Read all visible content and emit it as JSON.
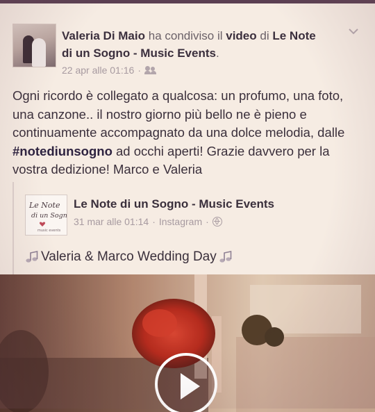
{
  "post": {
    "author": "Valeria Di Maio",
    "action_shared": "ha condiviso il",
    "object_video": "video",
    "prep": "di",
    "page_name": "Le Note di un Sogno - Music Events",
    "period": ".",
    "timestamp": "22 apr alle 01:16",
    "separator": "·",
    "audience_icon": "friends-icon",
    "menu_icon": "chevron-down-icon",
    "text_before_hashtag": "Ogni ricordo è collegato a qualcosa: un profumo, una foto, una canzone.. il nostro giorno più bello ne è pieno e continuamente accompagnato da una dolce melodia, dalle ",
    "hashtag": "#notediunsogno",
    "text_after_hashtag": " ad occhi aperti! Grazie davvero per la vostra dedizione! Marco e Valeria"
  },
  "shared": {
    "page_name": "Le Note di un Sogno - Music Events",
    "timestamp": "31 mar alle 01:14",
    "separator": "·",
    "source": "Instagram",
    "separator2": "·",
    "privacy_icon": "globe-icon",
    "logo_text_line1": "Le Note",
    "logo_text_line2": "di un Sogno",
    "logo_text_line3": "music events",
    "video_caption": "Valeria & Marco Wedding Day",
    "caption_icon": "music-note-icon",
    "play_icon": "play-icon"
  },
  "colors": {
    "accent_text": "#3a2f3b",
    "muted_text": "#a79aa0",
    "top_bar": "#5b3f52"
  }
}
